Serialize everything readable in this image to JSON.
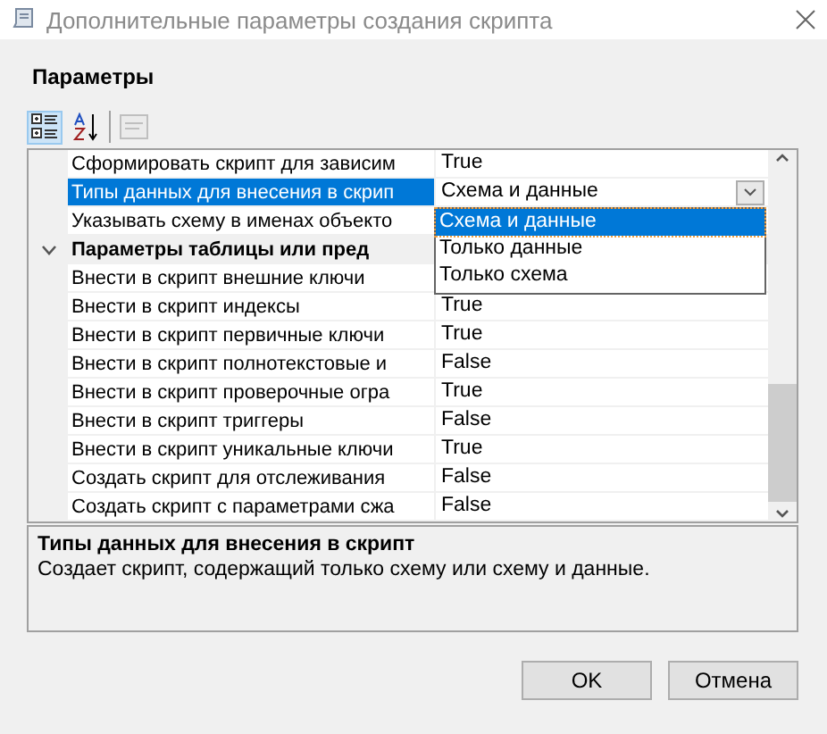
{
  "window": {
    "title": "Дополнительные параметры создания скрипта"
  },
  "section_title": "Параметры",
  "toolbar": [
    {
      "kind": "categorized",
      "selected": true
    },
    {
      "kind": "alphabetical",
      "selected": false
    },
    {
      "kind": "pages",
      "selected": false,
      "disabled": true
    }
  ],
  "properties": [
    {
      "kind": "property",
      "name": "Сформировать скрипт для зависим",
      "value": "True",
      "selected": false
    },
    {
      "kind": "property",
      "name": "Типы данных для внесения в скрип",
      "value": "Схема и данные",
      "selected": true
    },
    {
      "kind": "property",
      "name": "Указывать схему в именах объекто",
      "selected": false
    },
    {
      "kind": "category",
      "name": "Параметры таблицы или пред",
      "expanded": true,
      "selected": false
    },
    {
      "kind": "property",
      "name": "Внести в скрипт внешние ключи",
      "selected": false
    },
    {
      "kind": "property",
      "name": "Внести в скрипт индексы",
      "value": "True",
      "selected": false
    },
    {
      "kind": "property",
      "name": "Внести в скрипт первичные ключи",
      "value": "True",
      "selected": false
    },
    {
      "kind": "property",
      "name": "Внести в скрипт полнотекстовые и",
      "value": "False",
      "selected": false
    },
    {
      "kind": "property",
      "name": "Внести в скрипт проверочные огра",
      "value": "True",
      "selected": false
    },
    {
      "kind": "property",
      "name": "Внести в скрипт триггеры",
      "value": "False",
      "selected": false
    },
    {
      "kind": "property",
      "name": "Внести в скрипт уникальные ключи",
      "value": "True",
      "selected": false
    },
    {
      "kind": "property",
      "name": "Создать скрипт для отслеживания",
      "value": "False",
      "selected": false
    },
    {
      "kind": "property",
      "name": "Создать скрипт с параметрами сжа",
      "value": "False",
      "selected": false
    }
  ],
  "dropdown": {
    "options": [
      {
        "label": "Схема и данные",
        "selected": true
      },
      {
        "label": "Только данные",
        "selected": false
      },
      {
        "label": "Только схема",
        "selected": false
      }
    ]
  },
  "description": {
    "title": "Типы данных для внесения в скрипт",
    "text": "Создает скрипт, содержащий только схему или схему и данные."
  },
  "buttons": [
    "OK",
    "Отмена"
  ]
}
